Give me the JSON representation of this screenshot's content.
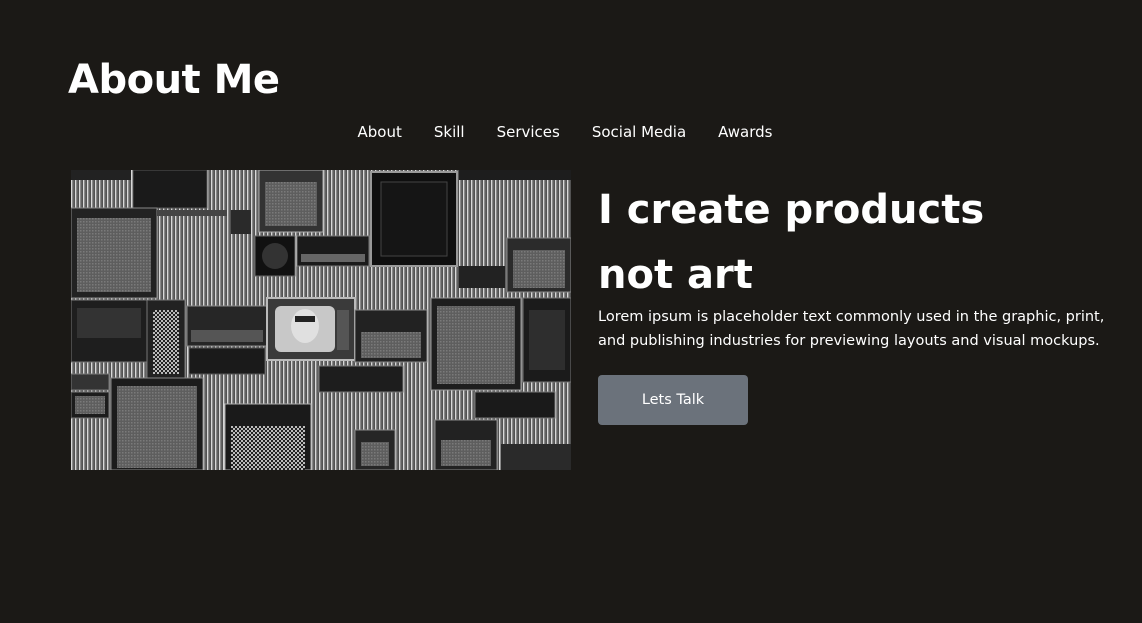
{
  "header": {
    "title": "About Me"
  },
  "nav": {
    "items": [
      {
        "label": "About"
      },
      {
        "label": "Skill"
      },
      {
        "label": "Services"
      },
      {
        "label": "Social Media"
      },
      {
        "label": "Awards"
      }
    ]
  },
  "hero": {
    "image_description": "black-and-white photo of stacked guitar amplifiers and vinyl records",
    "headline_line1": "I create products",
    "headline_line2": "not art",
    "description": "Lorem ipsum is placeholder text commonly used in the graphic, print, and publishing industries for previewing layouts and visual mockups.",
    "cta_label": "Lets Talk"
  },
  "colors": {
    "background": "#1b1916",
    "text": "#ffffff",
    "button": "#6b727b"
  }
}
